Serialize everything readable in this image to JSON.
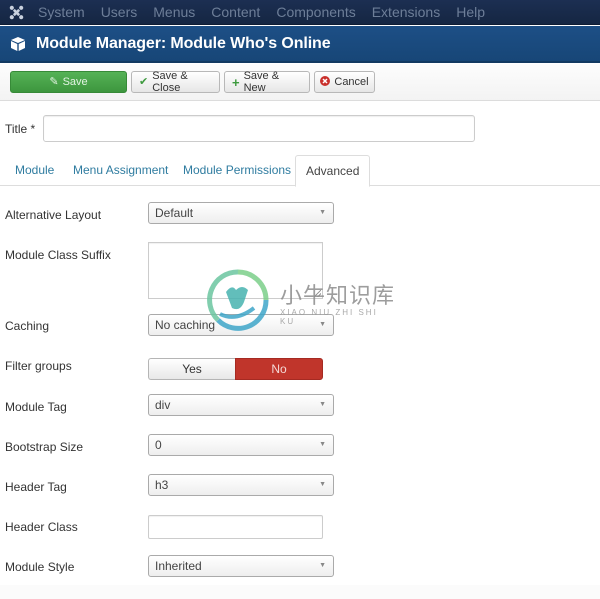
{
  "topnav": {
    "logo_icon": "joomla-logo-icon",
    "items": [
      "System",
      "Users",
      "Menus",
      "Content",
      "Components",
      "Extensions",
      "Help"
    ]
  },
  "header": {
    "icon": "cube-icon",
    "title": "Module Manager: Module Who's Online"
  },
  "toolbar": {
    "save": {
      "label": "Save",
      "icon": "edit-icon",
      "color": "#47a447"
    },
    "save_close": {
      "label": "Save & Close",
      "icon": "check-icon"
    },
    "save_new": {
      "label": "Save & New",
      "icon": "plus-icon"
    },
    "cancel": {
      "label": "Cancel",
      "icon": "cancel-icon"
    }
  },
  "title_field": {
    "label": "Title *",
    "value": "",
    "placeholder": ""
  },
  "tabs": [
    {
      "label": "Module",
      "active": false
    },
    {
      "label": "Menu Assignment",
      "active": false
    },
    {
      "label": "Module Permissions",
      "active": false
    },
    {
      "label": "Advanced",
      "active": true
    }
  ],
  "form": {
    "alternative_layout": {
      "label": "Alternative Layout",
      "value": "Default"
    },
    "module_class_suffix": {
      "label": "Module Class Suffix",
      "value": ""
    },
    "caching": {
      "label": "Caching",
      "value": "No caching"
    },
    "filter_groups": {
      "label": "Filter groups",
      "options": [
        "Yes",
        "No"
      ],
      "selected": "No",
      "selected_color": "#bd362f"
    },
    "module_tag": {
      "label": "Module Tag",
      "value": "div"
    },
    "bootstrap_size": {
      "label": "Bootstrap Size",
      "value": "0"
    },
    "header_tag": {
      "label": "Header Tag",
      "value": "h3"
    },
    "header_class": {
      "label": "Header Class",
      "value": ""
    },
    "module_style": {
      "label": "Module Style",
      "value": "Inherited"
    }
  },
  "watermark": {
    "chinese": "小牛知识库",
    "pinyin": "XIAO NIU ZHI SHI KU"
  },
  "colors": {
    "nav_bg": "#1a2c4e",
    "header_bg": "#1b4a80",
    "tab_link": "#2f7ca0"
  }
}
